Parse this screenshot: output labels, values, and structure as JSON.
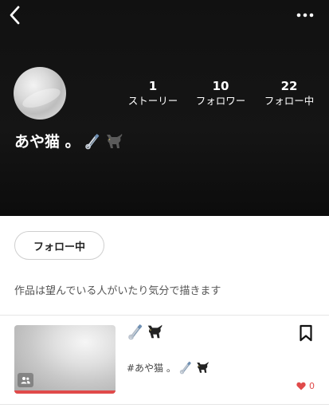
{
  "header": {
    "back_icon": "chevron-left-icon",
    "more_icon": "more-horizontal-icon"
  },
  "profile": {
    "name": "あや猫 。",
    "name_emoji": [
      "safety-pin-icon",
      "black-cat-icon"
    ],
    "stats": {
      "stories": {
        "count": "1",
        "label": "ストーリー"
      },
      "followers": {
        "count": "10",
        "label": "フォロワー"
      },
      "following": {
        "count": "22",
        "label": "フォロー中"
      }
    },
    "follow_button_label": "フォロー中",
    "bio": "作品は望んでいる人がいたり気分で描きます"
  },
  "stories": [
    {
      "title_icons": [
        "safety-pin-icon",
        "black-cat-icon"
      ],
      "tag": "#あや猫 。",
      "likes": "0",
      "read_progress": 1.0
    }
  ],
  "colors": {
    "header_bg": "#111111",
    "accent": "#e04a4a"
  }
}
